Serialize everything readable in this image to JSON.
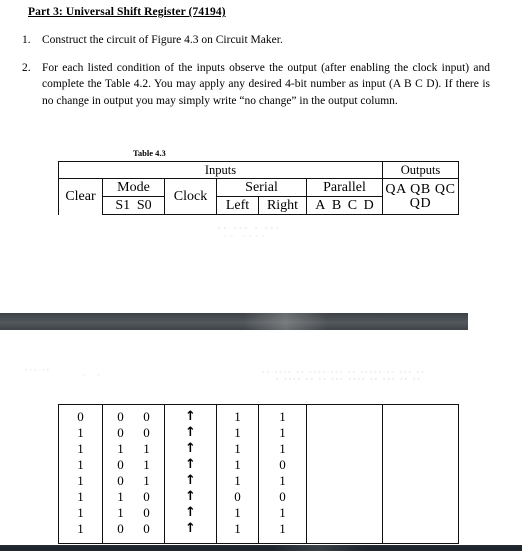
{
  "document": {
    "part_heading": "Part 3: Universal Shift Register (74194)",
    "steps": [
      {
        "number": "1.",
        "text": "Construct the circuit of Figure 4.3 on Circuit Maker."
      },
      {
        "number": "2.",
        "text": "For each listed condition of the inputs observe the output (after enabling the clock input) and complete the Table 4.2. You may apply any desired 4-bit number as input (A B C D). If there is no change in output you may simply write “no change” in the output column."
      }
    ],
    "table_caption": "Table 4.3"
  },
  "header_table": {
    "group_inputs": "Inputs",
    "group_outputs": "Outputs",
    "clear": "Clear",
    "mode": "Mode",
    "mode_s1": "S1",
    "mode_s0": "S0",
    "clock": "Clock",
    "serial": "Serial",
    "serial_left": "Left",
    "serial_right": "Right",
    "parallel": "Parallel",
    "parallel_a": "A",
    "parallel_b": "B",
    "parallel_c": "C",
    "parallel_d": "D",
    "outputs_q": "QA  QB  QC  QD"
  },
  "data_table": {
    "clock_glyph": "↑",
    "rows": [
      {
        "clear": "0",
        "s1": "0",
        "s0": "0",
        "clock": "↑",
        "left": "1",
        "right": "1",
        "parallel": "",
        "outputs": ""
      },
      {
        "clear": "1",
        "s1": "0",
        "s0": "0",
        "clock": "↑",
        "left": "1",
        "right": "1",
        "parallel": "",
        "outputs": ""
      },
      {
        "clear": "1",
        "s1": "1",
        "s0": "1",
        "clock": "↑",
        "left": "1",
        "right": "1",
        "parallel": "",
        "outputs": ""
      },
      {
        "clear": "1",
        "s1": "0",
        "s0": "1",
        "clock": "↑",
        "left": "1",
        "right": "0",
        "parallel": "",
        "outputs": ""
      },
      {
        "clear": "1",
        "s1": "0",
        "s0": "1",
        "clock": "↑",
        "left": "1",
        "right": "1",
        "parallel": "",
        "outputs": ""
      },
      {
        "clear": "1",
        "s1": "1",
        "s0": "0",
        "clock": "↑",
        "left": "0",
        "right": "0",
        "parallel": "",
        "outputs": ""
      },
      {
        "clear": "1",
        "s1": "1",
        "s0": "0",
        "clock": "↑",
        "left": "1",
        "right": "1",
        "parallel": "",
        "outputs": ""
      },
      {
        "clear": "1",
        "s1": "0",
        "s0": "0",
        "clock": "↑",
        "left": "1",
        "right": "1",
        "parallel": "",
        "outputs": ""
      }
    ]
  },
  "colors": {
    "bar": "#4a4f53",
    "bar_bottom": "#232b33",
    "rule": "#111111",
    "text": "#000000"
  }
}
